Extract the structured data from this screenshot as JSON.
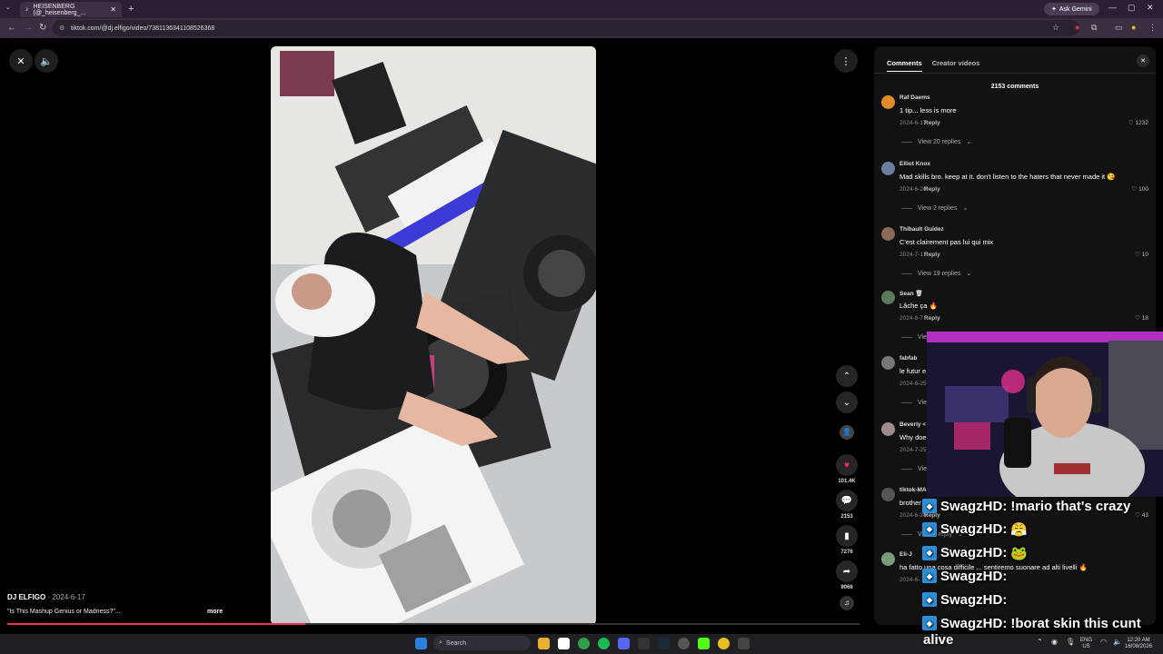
{
  "browser": {
    "tab_title": "HEISENBERG (@_heisenberg_...",
    "tab_close": "✕",
    "new_tab": "+",
    "ask_gemini": "Ask Gemini",
    "url": "tiktok.com/@dj.elfigo/video/7381136341108526368"
  },
  "video": {
    "author": "DJ ELFIGO",
    "date_sep": " · ",
    "date": "2024-6-17",
    "caption": "\"Is This Mashup Genius or Madness?\"...",
    "more_label": "more",
    "progress_fraction": 0.35
  },
  "rail": {
    "likes": "101.4K",
    "comments": "2153",
    "saves": "7276",
    "shares": "9066"
  },
  "panel": {
    "tab_comments": "Comments",
    "tab_creator": "Creator videos",
    "close": "✕",
    "count": "2153 comments",
    "comments": [
      {
        "user": "Raf Daems",
        "text": "1 tip... less is more",
        "date": "2024-6-17",
        "reply": "Reply",
        "likes": "1232",
        "view": "View 20 replies",
        "color": "#e08a2a"
      },
      {
        "user": "Elliot Knox",
        "text": "Mad skills bro. keep at it. don't listen to the haters that never made it 😘",
        "date": "2024-6-20",
        "reply": "Reply",
        "likes": "100",
        "view": "View 2 replies",
        "color": "#6a7fa0"
      },
      {
        "user": "Thibault Guidez",
        "text": "C'est clairement pas lui qui mix",
        "date": "2024-7-1",
        "reply": "Reply",
        "likes": "10",
        "view": "View 19 replies",
        "color": "#8a6a55"
      },
      {
        "user": "Sean 🗑",
        "text": "Lâche ça 🔥",
        "date": "2024-8-7",
        "reply": "Reply",
        "likes": "18",
        "view": "View",
        "color": "#5a7a5a"
      },
      {
        "user": "fabfab",
        "text": "le futur e",
        "date": "2024-6-25",
        "reply": "",
        "likes": "",
        "view": "View",
        "color": "#777777"
      },
      {
        "user": "Beverly <",
        "text": "Why doe",
        "date": "2024-7-25",
        "reply": "",
        "likes": "",
        "view": "View",
        "color": "#a08a8a"
      },
      {
        "user": "tiktok-MA",
        "text": "brother",
        "date": "2024-6-20",
        "reply": "Reply",
        "likes": "43",
        "view": "View 1 reply",
        "color": "#555555"
      },
      {
        "user": "Eli-J",
        "text": "ha fatto una cosa difficile ... sentiremo suonare ad alti livelli 🔥",
        "date": "2024-6-",
        "reply": "",
        "likes": "",
        "view": "",
        "color": "#7a9a7a"
      }
    ]
  },
  "stream_chat": [
    {
      "user": "SwagzHD:",
      "msg": "!mario that's crazy"
    },
    {
      "user": "SwagzHD:",
      "msg": "😤"
    },
    {
      "user": "SwagzHD:",
      "msg": "🐸"
    },
    {
      "user": "SwagzHD:",
      "msg": ""
    },
    {
      "user": "SwagzHD:",
      "msg": ""
    },
    {
      "user": "SwagzHD:",
      "msg": "!borat skin this cunt"
    }
  ],
  "overlay_text": "alive",
  "taskbar": {
    "search": "Search",
    "lang": "ENG",
    "region": "US",
    "time": "12:20 AM",
    "date": "16/08/2026"
  }
}
